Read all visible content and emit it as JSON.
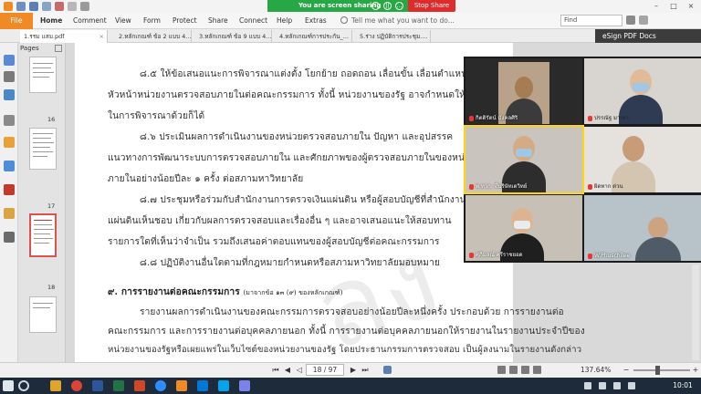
{
  "sharing": {
    "banner_text": "You are screen sharing",
    "stop_label": "Stop Share",
    "ctl_info": "i",
    "ctl_pause": "||",
    "ctl_more": "..."
  },
  "window_controls": {
    "minimize": "–",
    "maximize": "□",
    "close": "×"
  },
  "ribbon": {
    "file_label": "File",
    "menu": [
      "Home",
      "Comment",
      "View",
      "Form",
      "Protect",
      "Share",
      "Connect",
      "Help",
      "Extras"
    ],
    "tell_me_placeholder": "Tell me what you want to do...",
    "find_placeholder": "Find"
  },
  "tabs": [
    "1.รรม แสม.pdf",
    "2.หลักเกณฑ์ ข้อ 2 แบบ 4...",
    "3.หลักเกณฑ์ ข้อ 9 แบบ 4...",
    "4.หลักเกณฑ์การประกัน_...",
    "5.ร่าง ปฏิบัติการประชุม...."
  ],
  "tab_close": "×",
  "esign_label": "eSign PDF Docs",
  "pages_panel": {
    "title": "Pages",
    "page_numbers": [
      "16",
      "17",
      "18"
    ]
  },
  "document": {
    "lines": [
      "๘.๕  ให้ข้อเสนอแนะการพิจารณาแต่งตั้ง โยกย้าย ถอดถอน เลื่อนขั้น เลื่อนตำแหน่ง และ",
      "หัวหน้าหน่วยงานตรวจสอบภายในต่อคณะกรรมการ ทั้งนี้ หน่วยงานของรัฐ อาจกำหนดให้หัวหน้าหน่วยงาน",
      "ในการพิจารณาด้วยก็ได้",
      "๘.๖  ประเมินผลการดำเนินงานของหน่วยตรวจสอบภายใน ปัญหา และอุปสรรค",
      "แนวทางการพัฒนาระบบการตรวจสอบภายใน และศักยภาพของผู้ตรวจสอบภายในของหน่วยงาน",
      "ภายในอย่างน้อยปีละ ๑ ครั้ง ต่อสภามหาวิทยาลัย",
      "๘.๗  ประชุมหรือร่วมกับสำนักงานการตรวจเงินแผ่นดิน หรือผู้สอบบัญชีที่สำนักงาน",
      "แผ่นดินเห็นชอบ เกี่ยวกับผลการตรวจสอบและเรื่องอื่น ๆ และอาจเสนอแนะให้สอบทาน",
      "รายการใดที่เห็นว่าจำเป็น รวมถึงเสนอค่าตอบแทนของผู้สอบบัญชีต่อคณะกรรมการ",
      "๘.๘  ปฏิบัติงานอื่นใดตามที่กฎหมายกำหนดหรือสภามหาวิทยาลัยมอบหมาย",
      "๙.  การรายงานต่อคณะกรรมการ",
      "รายงานผลการดำเนินงานของคณะกรรมการตรวจสอบอย่างน้อยปีละหนึ่งครั้ง ประกอบด้วย การรายงานต่อ",
      "คณะกรรมการ และการรายงานต่อบุคคลภายนอก ทั้งนี้ การรายงานต่อบุคคลภายนอกให้รายงานในรายงานประจำปีของ",
      "หน่วยงานของรัฐหรือเผยแพร่ในเว็บไซต์ของหน่วยงานของรัฐ โดยประธานกรรมการตรวจสอบ เป็นผู้ลงนามในรายงานดังกล่าว"
    ],
    "heading_note": "(มาจากข้อ ๑๓ (๙) ของหลักเกณฑ์)"
  },
  "participants": [
    {
      "name": "กิตติรัตน์ มังคลศิริ"
    },
    {
      "name": "ปรรณัฐ มาเท่า"
    },
    {
      "name": "พ.ทวก. ที่บริษัทเดวิทย์"
    },
    {
      "name": "ผิดทาก ด่วน"
    },
    {
      "name": "ศุภิมลณ์ ศรีราชยอด"
    },
    {
      "name": "W.Phuschilee"
    }
  ],
  "statusbar": {
    "first": "⏮",
    "prev": "◀",
    "next": "▶",
    "last": "⏭",
    "page_display": "18 / 97",
    "zoom": "137.64%",
    "zoom_out": "−",
    "zoom_in": "+"
  },
  "taskbar": {
    "clock": "10:01"
  },
  "colors": {
    "accent_orange": "#f08a24",
    "share_green": "#28a745",
    "stop_red": "#e02b2b",
    "esign_dark": "#3c3c3c"
  }
}
